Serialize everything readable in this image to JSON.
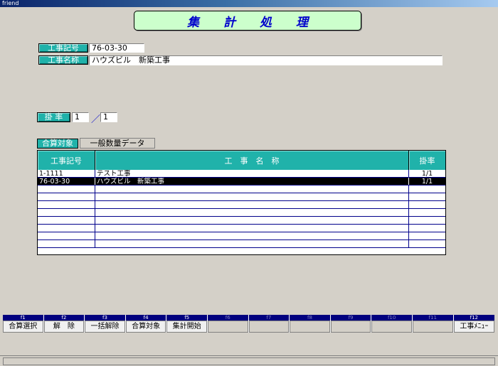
{
  "window": {
    "title": "friend"
  },
  "header": {
    "title": "集計処理"
  },
  "form": {
    "koji_kigo_label": "工事記号",
    "koji_kigo_value": "76-03-30",
    "koji_meisho_label": "工事名称",
    "koji_meisho_value": "ハウズビル　新築工事",
    "kakeritsu_label": "掛 率",
    "kakeritsu_num": "1",
    "kakeritsu_sep": "／",
    "kakeritsu_den": "1"
  },
  "tabs": {
    "active": "合算対象",
    "inactive": "一般数量データ"
  },
  "table": {
    "columns": [
      "工事記号",
      "工　事　名　称",
      "掛率"
    ],
    "rows": [
      {
        "code": "1-1111",
        "name": "テスト工事",
        "rate": "1/1"
      },
      {
        "code": "76-03-30",
        "name": "ハウズビル　新築工事",
        "rate": "1/1"
      }
    ],
    "selected_row": 1
  },
  "fkeys": [
    {
      "key": "f1",
      "label": "合算選択"
    },
    {
      "key": "f2",
      "label": "解　除"
    },
    {
      "key": "f3",
      "label": "一括解除"
    },
    {
      "key": "f4",
      "label": "合算対象"
    },
    {
      "key": "f5",
      "label": "集計開始"
    },
    {
      "key": "f6",
      "label": ""
    },
    {
      "key": "f7",
      "label": ""
    },
    {
      "key": "f8",
      "label": ""
    },
    {
      "key": "f9",
      "label": ""
    },
    {
      "key": "f10",
      "label": ""
    },
    {
      "key": "f11",
      "label": ""
    },
    {
      "key": "f12",
      "label": "工事ﾒﾆｭｰ"
    }
  ],
  "colors": {
    "accent": "#20b2aa",
    "title_bg": "#ccffcc",
    "title_text": "#0000cc",
    "grid_line": "#00008b"
  }
}
